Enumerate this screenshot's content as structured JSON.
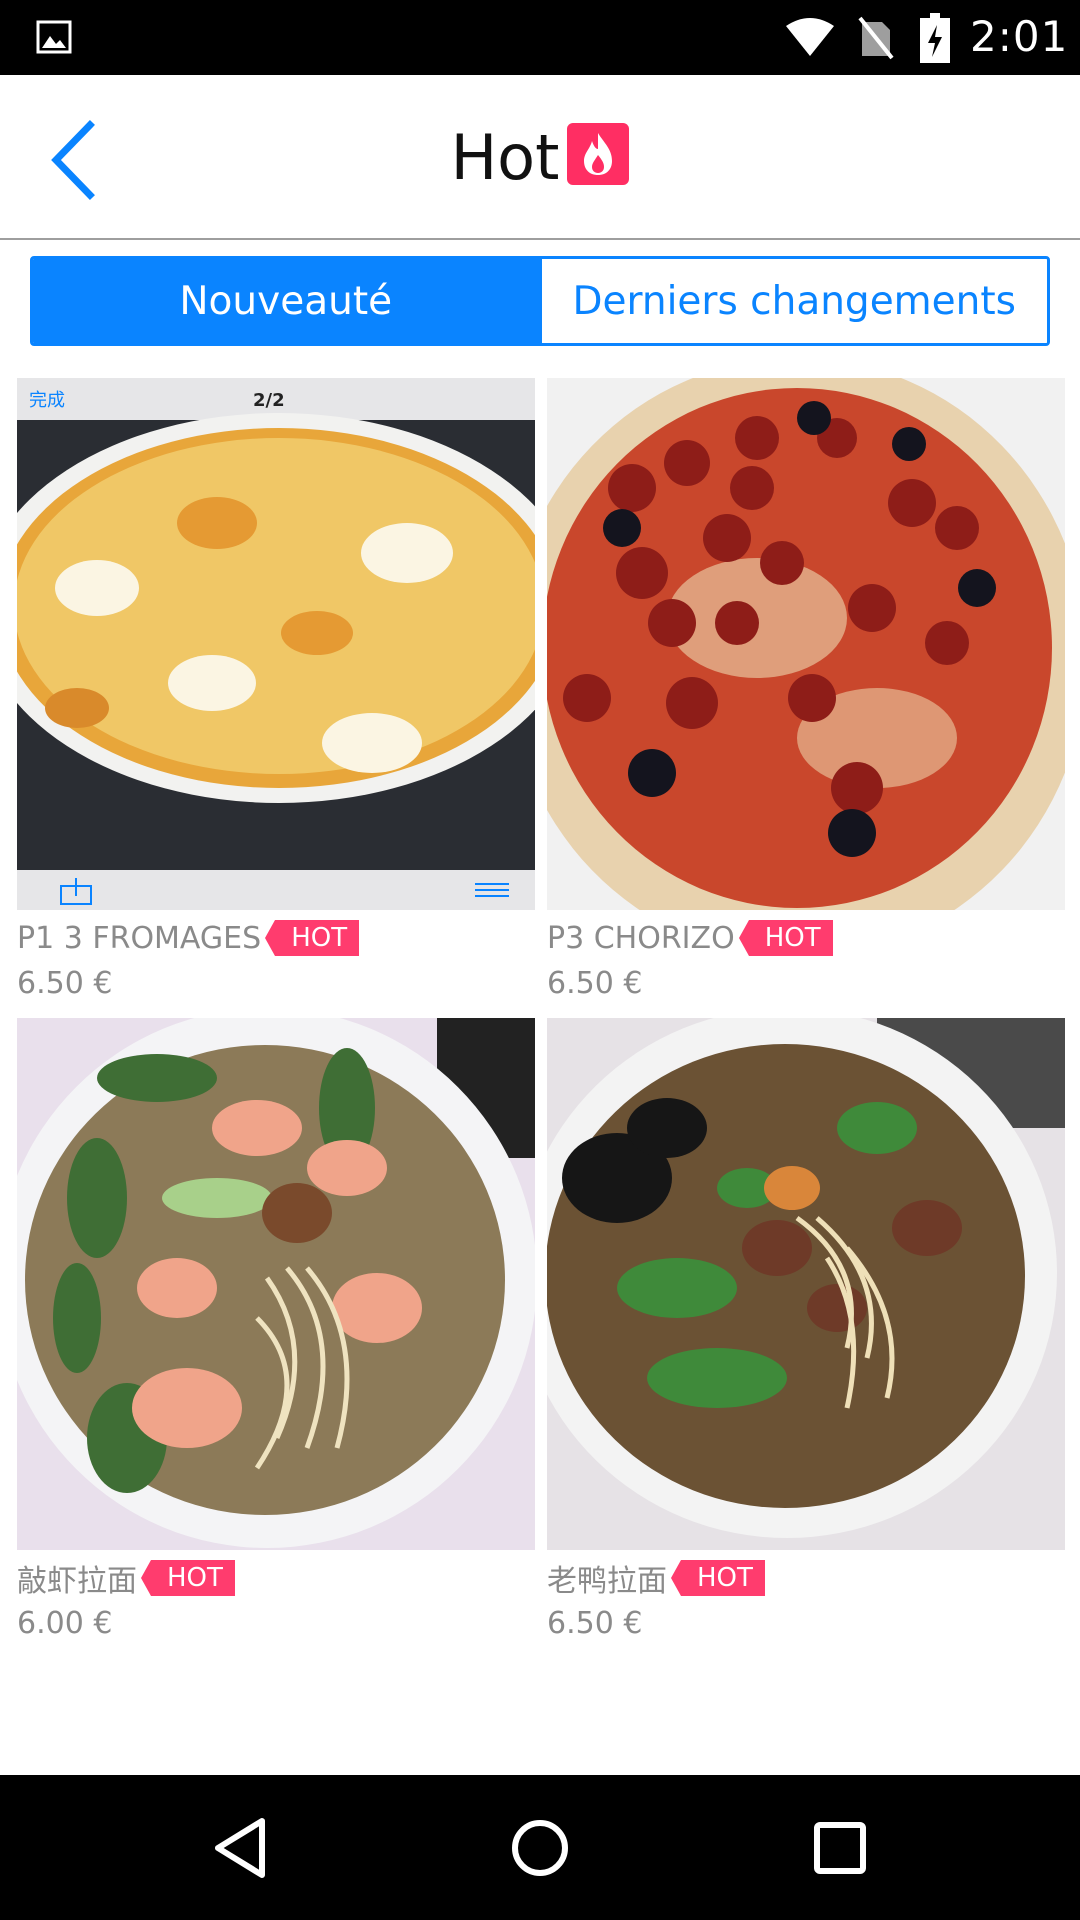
{
  "status_bar": {
    "time": "2:01"
  },
  "header": {
    "title": "Hot"
  },
  "tabs": [
    {
      "label": "Nouveauté",
      "active": true
    },
    {
      "label": "Derniers changements",
      "active": false
    }
  ],
  "screenshot_overlay": {
    "done_label": "完成",
    "page_counter": "2/2"
  },
  "products": [
    {
      "name": "P1 3 FROMAGES",
      "badge": "HOT",
      "price": "6.50 €"
    },
    {
      "name": "P3 CHORIZO",
      "badge": "HOT",
      "price": "6.50 €"
    },
    {
      "name": "敲虾拉面",
      "badge": "HOT",
      "price": "6.00 €"
    },
    {
      "name": "老鸭拉面",
      "badge": "HOT",
      "price": "6.50 €"
    }
  ],
  "colors": {
    "accent": "#0a84ff",
    "hot": "#ff3c6e",
    "text_muted": "#8a8a8a"
  },
  "icons": {
    "status": [
      "gallery-icon",
      "wifi-icon",
      "no-sim-icon",
      "battery-charging-icon"
    ],
    "nav": [
      "back-triangle-icon",
      "home-circle-icon",
      "recents-square-icon"
    ]
  }
}
